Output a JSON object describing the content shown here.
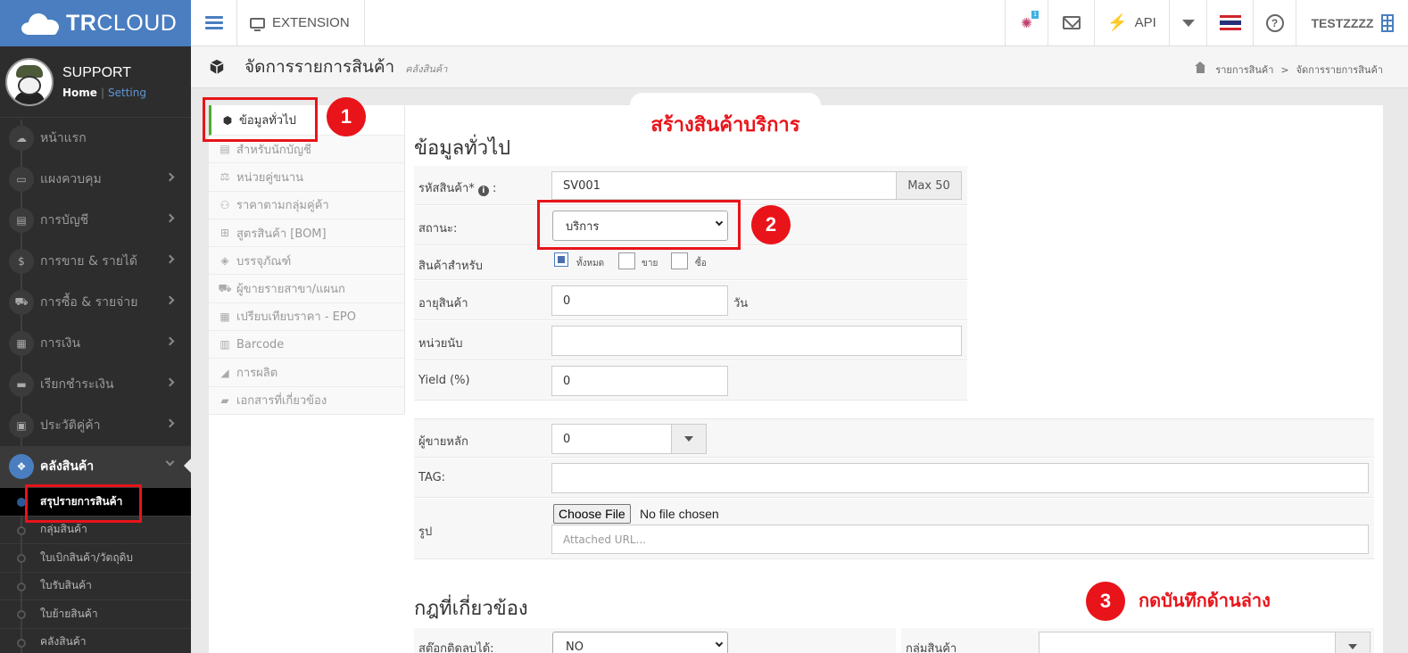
{
  "brand": {
    "logo_bold": "TR",
    "logo_light": "CLOUD"
  },
  "topbar": {
    "extension_label": "EXTENSION",
    "notification_badge": "1",
    "api_label": "API",
    "user_label": "TESTZZZZ"
  },
  "profile": {
    "name": "SUPPORT",
    "home_link": "Home",
    "separator": "|",
    "setting_link": "Setting"
  },
  "sidebar": {
    "items": [
      {
        "label": "หน้าแรก",
        "icon": "cloud-icon"
      },
      {
        "label": "แผงควบคุม",
        "icon": "monitor-icon"
      },
      {
        "label": "การบัญชี",
        "icon": "book-icon"
      },
      {
        "label": "การขาย & รายได้",
        "icon": "dollar-icon"
      },
      {
        "label": "การซื้อ & รายจ่าย",
        "icon": "cart-icon"
      },
      {
        "label": "การเงิน",
        "icon": "calendar-icon"
      },
      {
        "label": "เรียกชำระเงิน",
        "icon": "credit-card-icon"
      },
      {
        "label": "ประวัติคู่ค้า",
        "icon": "address-book-icon"
      }
    ],
    "active_item": {
      "label": "คลังสินค้า",
      "icon": "cubes-icon"
    },
    "sub_items": [
      "สรุปรายการสินค้า",
      "กลุ่มสินค้า",
      "ใบเบิกสินค้า/วัตถุดิบ",
      "ใบรับสินค้า",
      "ใบย้ายสินค้า",
      "คลังสินค้า"
    ]
  },
  "page": {
    "title": "จัดการรายการสินค้า",
    "subtitle": "คลังสินค้า",
    "breadcrumb": [
      "รายการสินค้า",
      "จัดการรายการสินค้า"
    ],
    "breadcrumb_sep": ">"
  },
  "tabs": [
    {
      "label": "ข้อมูลทั่วไป",
      "icon": "cube-icon"
    },
    {
      "label": "สำหรับนักบัญชี",
      "icon": "book-icon"
    },
    {
      "label": "หน่วยคู่ขนาน",
      "icon": "balance-scale-icon"
    },
    {
      "label": "ราคาตามกลุ่มคู่ค้า",
      "icon": "users-icon"
    },
    {
      "label": "สูตรสินค้า [BOM]",
      "icon": "sitemap-icon"
    },
    {
      "label": "บรรจุภัณฑ์",
      "icon": "dropbox-icon"
    },
    {
      "label": "ผู้ขายรายสาขา/แผนก",
      "icon": "cart-icon"
    },
    {
      "label": "เปรียบเทียบราคา - EPO",
      "icon": "table-icon"
    },
    {
      "label": "Barcode",
      "icon": "barcode-icon"
    },
    {
      "label": "การผลิต",
      "icon": "area-chart-icon"
    },
    {
      "label": "เอกสารที่เกี่ยวข้อง",
      "icon": "folder-icon"
    }
  ],
  "form": {
    "section_title": "ข้อมูลทั่วไป",
    "code_label": "รหัสสินค้า*",
    "code_colon": ":",
    "code_value": "SV001",
    "code_max": "Max 50",
    "status_label": "สถานะ:",
    "status_value": "บริการ",
    "product_for_label": "สินค้าสำหรับ",
    "product_for_options": [
      "ทั้งหมด",
      "ขาย",
      "ซื้อ"
    ],
    "age_label": "อายุสินค้า",
    "age_value": "0",
    "age_unit": "วัน",
    "unit_label": "หน่วยนับ",
    "unit_value": "",
    "yield_label": "Yield (%)",
    "yield_value": "0",
    "vendor_label": "ผู้ขายหลัก",
    "vendor_value": "0",
    "tag_label": "TAG:",
    "tag_value": "",
    "image_label": "รูป",
    "file_button": "Choose File",
    "file_status": "No file chosen",
    "url_placeholder": "Attached URL...",
    "rules_title": "กฎที่เกี่ยวข้อง",
    "negative_stock_label": "สต๊อกติดลบได้:",
    "negative_stock_value": "NO",
    "product_group_label": "กลุ่มสินค้า"
  },
  "annotations": {
    "num1": "1",
    "num2": "2",
    "num3": "3",
    "callout": "สร้างสินค้าบริการ",
    "note3": "กดบันทึกด้านล่าง"
  },
  "colors": {
    "accent": "#4a7ec0",
    "annotation_red": "#e8141a",
    "sidebar_bg": "#2d2d2d",
    "active_tab_marker": "#55aa33"
  }
}
